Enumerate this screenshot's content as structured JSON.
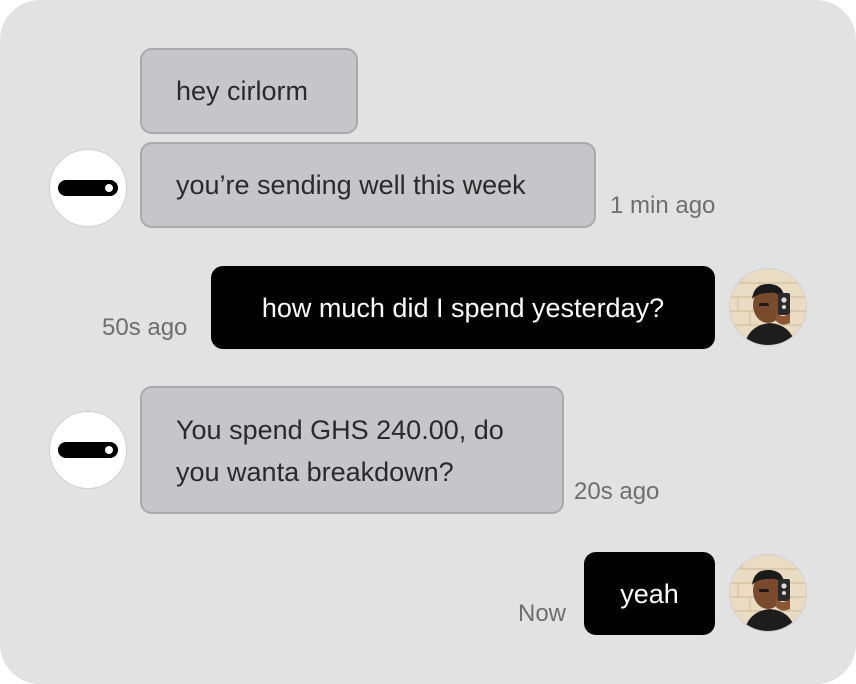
{
  "messages": [
    {
      "sender": "bot",
      "text": "hey cirlorm"
    },
    {
      "sender": "bot",
      "text": "you’re sending well this week",
      "time": "1 min ago"
    },
    {
      "sender": "user",
      "text": "how much did I spend yesterday?",
      "time": "50s ago"
    },
    {
      "sender": "bot",
      "text": "You spend GHS 240.00, do you wanta breakdown?",
      "time": "20s ago"
    },
    {
      "sender": "user",
      "text": "yeah",
      "time": "Now"
    }
  ],
  "icons": {
    "bot_avatar": "pill-logo-icon",
    "user_avatar": "person-selfie-icon"
  },
  "colors": {
    "background": "#e2e2e2",
    "incoming_bubble": "#c6c6c8",
    "outgoing_bubble": "#000000",
    "timestamp": "#6e6e6e"
  }
}
